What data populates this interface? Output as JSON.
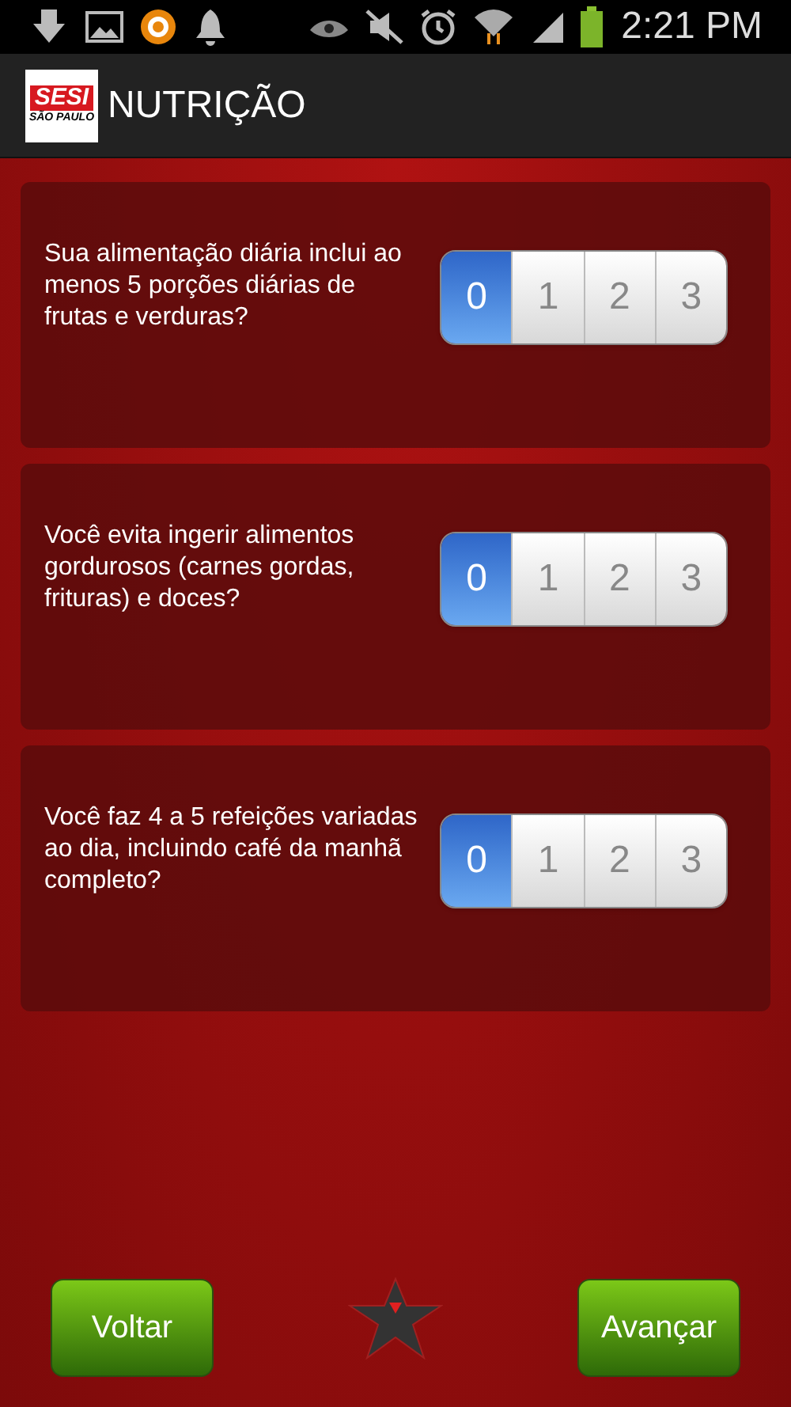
{
  "status_bar": {
    "time": "2:21 PM"
  },
  "app_bar": {
    "logo": {
      "name": "SESI",
      "region": "SÃO PAULO"
    },
    "title": "NUTRIÇÃO"
  },
  "questions": [
    {
      "text": "Sua alimentação diária inclui ao menos 5 porções diárias de frutas e verduras?",
      "options": [
        {
          "label": "0",
          "selected": true
        },
        {
          "label": "1",
          "selected": false
        },
        {
          "label": "2",
          "selected": false
        },
        {
          "label": "3",
          "selected": false
        }
      ]
    },
    {
      "text": "Você evita ingerir alimentos gordurosos (carnes gordas, frituras) e doces?",
      "options": [
        {
          "label": "0",
          "selected": true
        },
        {
          "label": "1",
          "selected": false
        },
        {
          "label": "2",
          "selected": false
        },
        {
          "label": "3",
          "selected": false
        }
      ]
    },
    {
      "text": "Você faz 4 a 5 refeições variadas ao dia, incluindo café da manhã completo?",
      "options": [
        {
          "label": "0",
          "selected": true
        },
        {
          "label": "1",
          "selected": false
        },
        {
          "label": "2",
          "selected": false
        },
        {
          "label": "3",
          "selected": false
        }
      ]
    }
  ],
  "buttons": {
    "back": "Voltar",
    "next": "Avançar"
  }
}
